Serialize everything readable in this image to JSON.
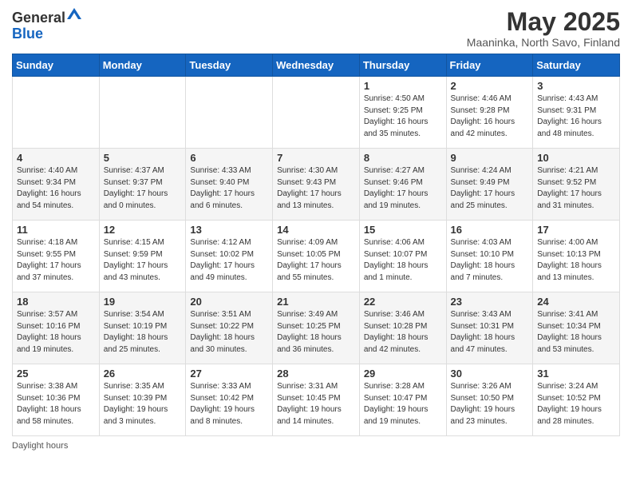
{
  "header": {
    "logo_general": "General",
    "logo_blue": "Blue",
    "title": "May 2025",
    "subtitle": "Maaninka, North Savo, Finland"
  },
  "footer": {
    "note": "Daylight hours"
  },
  "columns": [
    "Sunday",
    "Monday",
    "Tuesday",
    "Wednesday",
    "Thursday",
    "Friday",
    "Saturday"
  ],
  "weeks": [
    [
      {
        "day": "",
        "info": ""
      },
      {
        "day": "",
        "info": ""
      },
      {
        "day": "",
        "info": ""
      },
      {
        "day": "",
        "info": ""
      },
      {
        "day": "1",
        "info": "Sunrise: 4:50 AM\nSunset: 9:25 PM\nDaylight: 16 hours\nand 35 minutes."
      },
      {
        "day": "2",
        "info": "Sunrise: 4:46 AM\nSunset: 9:28 PM\nDaylight: 16 hours\nand 42 minutes."
      },
      {
        "day": "3",
        "info": "Sunrise: 4:43 AM\nSunset: 9:31 PM\nDaylight: 16 hours\nand 48 minutes."
      }
    ],
    [
      {
        "day": "4",
        "info": "Sunrise: 4:40 AM\nSunset: 9:34 PM\nDaylight: 16 hours\nand 54 minutes."
      },
      {
        "day": "5",
        "info": "Sunrise: 4:37 AM\nSunset: 9:37 PM\nDaylight: 17 hours\nand 0 minutes."
      },
      {
        "day": "6",
        "info": "Sunrise: 4:33 AM\nSunset: 9:40 PM\nDaylight: 17 hours\nand 6 minutes."
      },
      {
        "day": "7",
        "info": "Sunrise: 4:30 AM\nSunset: 9:43 PM\nDaylight: 17 hours\nand 13 minutes."
      },
      {
        "day": "8",
        "info": "Sunrise: 4:27 AM\nSunset: 9:46 PM\nDaylight: 17 hours\nand 19 minutes."
      },
      {
        "day": "9",
        "info": "Sunrise: 4:24 AM\nSunset: 9:49 PM\nDaylight: 17 hours\nand 25 minutes."
      },
      {
        "day": "10",
        "info": "Sunrise: 4:21 AM\nSunset: 9:52 PM\nDaylight: 17 hours\nand 31 minutes."
      }
    ],
    [
      {
        "day": "11",
        "info": "Sunrise: 4:18 AM\nSunset: 9:55 PM\nDaylight: 17 hours\nand 37 minutes."
      },
      {
        "day": "12",
        "info": "Sunrise: 4:15 AM\nSunset: 9:59 PM\nDaylight: 17 hours\nand 43 minutes."
      },
      {
        "day": "13",
        "info": "Sunrise: 4:12 AM\nSunset: 10:02 PM\nDaylight: 17 hours\nand 49 minutes."
      },
      {
        "day": "14",
        "info": "Sunrise: 4:09 AM\nSunset: 10:05 PM\nDaylight: 17 hours\nand 55 minutes."
      },
      {
        "day": "15",
        "info": "Sunrise: 4:06 AM\nSunset: 10:07 PM\nDaylight: 18 hours\nand 1 minute."
      },
      {
        "day": "16",
        "info": "Sunrise: 4:03 AM\nSunset: 10:10 PM\nDaylight: 18 hours\nand 7 minutes."
      },
      {
        "day": "17",
        "info": "Sunrise: 4:00 AM\nSunset: 10:13 PM\nDaylight: 18 hours\nand 13 minutes."
      }
    ],
    [
      {
        "day": "18",
        "info": "Sunrise: 3:57 AM\nSunset: 10:16 PM\nDaylight: 18 hours\nand 19 minutes."
      },
      {
        "day": "19",
        "info": "Sunrise: 3:54 AM\nSunset: 10:19 PM\nDaylight: 18 hours\nand 25 minutes."
      },
      {
        "day": "20",
        "info": "Sunrise: 3:51 AM\nSunset: 10:22 PM\nDaylight: 18 hours\nand 30 minutes."
      },
      {
        "day": "21",
        "info": "Sunrise: 3:49 AM\nSunset: 10:25 PM\nDaylight: 18 hours\nand 36 minutes."
      },
      {
        "day": "22",
        "info": "Sunrise: 3:46 AM\nSunset: 10:28 PM\nDaylight: 18 hours\nand 42 minutes."
      },
      {
        "day": "23",
        "info": "Sunrise: 3:43 AM\nSunset: 10:31 PM\nDaylight: 18 hours\nand 47 minutes."
      },
      {
        "day": "24",
        "info": "Sunrise: 3:41 AM\nSunset: 10:34 PM\nDaylight: 18 hours\nand 53 minutes."
      }
    ],
    [
      {
        "day": "25",
        "info": "Sunrise: 3:38 AM\nSunset: 10:36 PM\nDaylight: 18 hours\nand 58 minutes."
      },
      {
        "day": "26",
        "info": "Sunrise: 3:35 AM\nSunset: 10:39 PM\nDaylight: 19 hours\nand 3 minutes."
      },
      {
        "day": "27",
        "info": "Sunrise: 3:33 AM\nSunset: 10:42 PM\nDaylight: 19 hours\nand 8 minutes."
      },
      {
        "day": "28",
        "info": "Sunrise: 3:31 AM\nSunset: 10:45 PM\nDaylight: 19 hours\nand 14 minutes."
      },
      {
        "day": "29",
        "info": "Sunrise: 3:28 AM\nSunset: 10:47 PM\nDaylight: 19 hours\nand 19 minutes."
      },
      {
        "day": "30",
        "info": "Sunrise: 3:26 AM\nSunset: 10:50 PM\nDaylight: 19 hours\nand 23 minutes."
      },
      {
        "day": "31",
        "info": "Sunrise: 3:24 AM\nSunset: 10:52 PM\nDaylight: 19 hours\nand 28 minutes."
      }
    ]
  ]
}
